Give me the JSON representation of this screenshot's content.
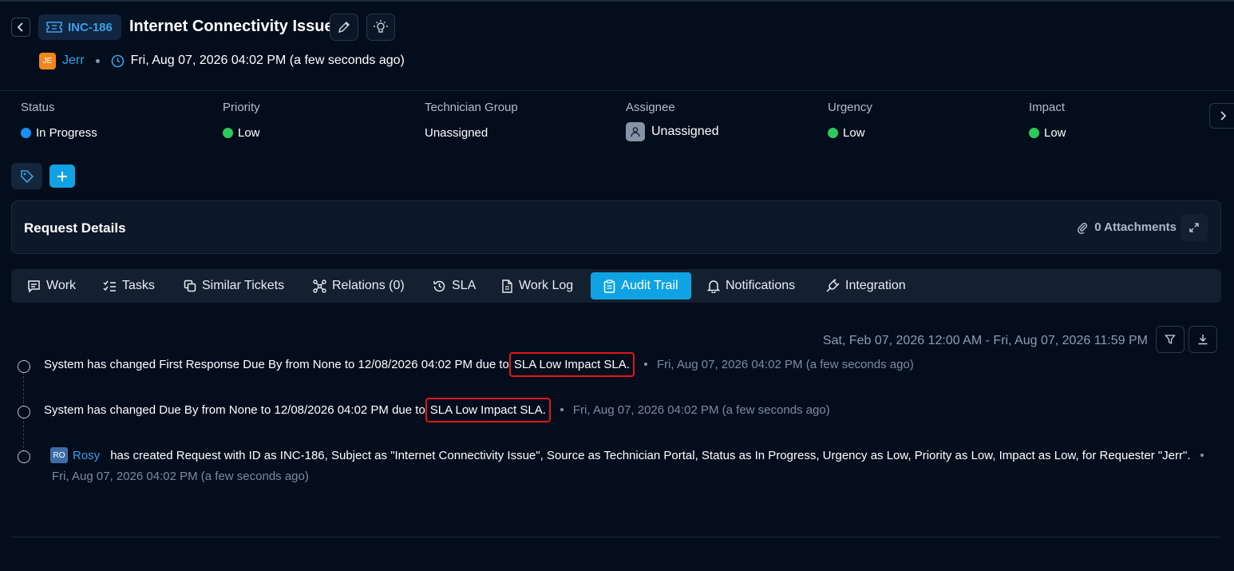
{
  "ticket": {
    "id": "INC-186",
    "title": "Internet Connectivity Issue",
    "requester_initials": "JE",
    "requester": "Jerr",
    "created": "Fri, Aug 07, 2026 04:02 PM (a few seconds ago)"
  },
  "fields": [
    {
      "label": "Status",
      "value": "In Progress",
      "dot": "#1c8ef2"
    },
    {
      "label": "Priority",
      "value": "Low",
      "dot": "#2ec95c"
    },
    {
      "label": "Technician Group",
      "value": "Unassigned"
    },
    {
      "label": "Assignee",
      "value": "Unassigned"
    },
    {
      "label": "Urgency",
      "value": "Low",
      "dot": "#2ec95c"
    },
    {
      "label": "Impact",
      "value": "Low",
      "dot": "#2ec95c"
    }
  ],
  "details": {
    "title": "Request Details",
    "attachments": "0 Attachments"
  },
  "tabs": [
    {
      "label": "Work",
      "icon": "message-icon"
    },
    {
      "label": "Tasks",
      "icon": "checklist-icon"
    },
    {
      "label": "Similar Tickets",
      "icon": "copy-icon"
    },
    {
      "label": "Relations (0)",
      "icon": "network-icon"
    },
    {
      "label": "SLA",
      "icon": "history-icon"
    },
    {
      "label": "Work Log",
      "icon": "document-icon"
    },
    {
      "label": "Audit Trail",
      "icon": "clipboard-icon",
      "active": true
    },
    {
      "label": "Notifications",
      "icon": "bell-icon"
    },
    {
      "label": "Integration",
      "icon": "plug-icon"
    }
  ],
  "audit": {
    "range": "Sat, Feb 07, 2026 12:00 AM - Fri, Aug 07, 2026 11:59 PM",
    "entries": [
      {
        "text": "System has changed First Response Due By from None to 12/08/2026 04:02 PM due to",
        "highlight": "SLA Low Impact SLA.",
        "time": "Fri, Aug 07, 2026 04:02 PM (a few seconds ago)"
      },
      {
        "text": "System has changed Due By from None to 12/08/2026 04:02 PM due to",
        "highlight": "SLA Low Impact SLA.",
        "time": "Fri, Aug 07, 2026 04:02 PM (a few seconds ago)"
      },
      {
        "user_initials": "RO",
        "user": "Rosy",
        "text": "has created Request with ID as INC-186, Subject as \"Internet Connectivity Issue\", Source as Technician Portal, Status as In Progress, Urgency as Low, Priority as Low, Impact as Low, for Requester \"Jerr\".",
        "time": "Fri, Aug 07, 2026 04:02 PM (a few seconds ago)"
      }
    ]
  }
}
